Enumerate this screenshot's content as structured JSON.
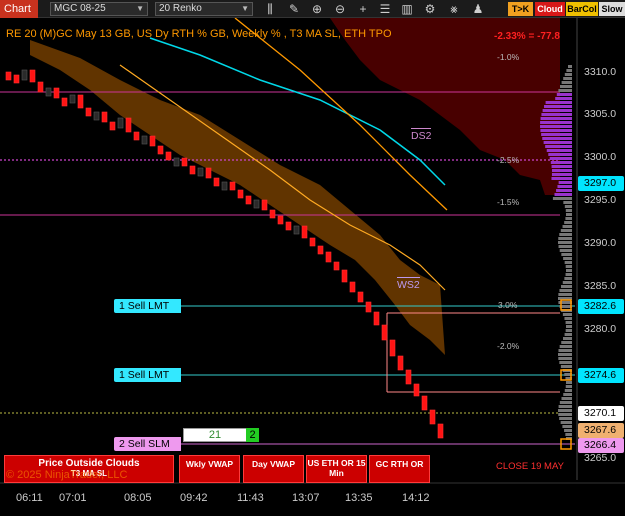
{
  "toolbar": {
    "title": "Chart",
    "instrument": "MGC 08-25",
    "bar_type": "20 Renko",
    "icons": [
      "bars-icon",
      "draw-icon",
      "zoom-in-icon",
      "zoom-out-icon",
      "add-icon",
      "list-icon",
      "chart-style-icon",
      "properties-icon",
      "indicators-icon",
      "strategies-icon"
    ],
    "buttons": {
      "tk": "T>K",
      "cloud": "Cloud",
      "barcol": "BarCol",
      "slow": "Slow"
    }
  },
  "header_text": "RE 20  (M)GC May 13 GB, US Dy RTH % GB, Weekly % , T3 MA SL, ETH TPO",
  "top_percent": "-2.33% = -77.8",
  "price_axis": [
    "3310.0",
    "3305.0",
    "3300.0",
    "3295.0",
    "3290.0",
    "3285.0",
    "3280.0",
    "3275.0",
    "3270.0",
    "3265.0"
  ],
  "time_axis": [
    "06:11",
    "07:01",
    "08:05",
    "09:42",
    "11:43",
    "13:07",
    "13:35",
    "14:12"
  ],
  "price_tags": {
    "cyan_top": "3297.0",
    "sell_1": "3282.6",
    "sell_2": "3274.6",
    "current": "3270.1",
    "bar_close": "3267.6",
    "slm": "3266.4"
  },
  "orders": [
    {
      "label": "1 Sell LMT"
    },
    {
      "label": "1 Sell LMT"
    },
    {
      "label": "2 Sell SLM"
    }
  ],
  "pct_labels": {
    "p1": "-1.0%",
    "p2": "-2.5%",
    "p3": "-1.5%",
    "p4": "3.0%",
    "p5": "-2.0%"
  },
  "annotations": {
    "ds2": "DS2",
    "ws2": "WS2"
  },
  "position_box": {
    "qty": "21",
    "count": "2"
  },
  "panels": {
    "price_outside": "Price Outside Clouds",
    "t3": "T3 MA SL",
    "wkly": "Wkly VWAP",
    "day": "Day VWAP",
    "us_eth": "US ETH OR 15 Min",
    "gc_rth": "GC RTH OR"
  },
  "close_note": "CLOSE 19 MAY",
  "copyright": "© 2025 NinjaTrader, LLC",
  "colors": {
    "up_bar": "#2a2a2a",
    "down_bar": "#ff1414",
    "cloud": "#a05a00",
    "upper_cloud": "#5a0000",
    "tpo": "#9933cc",
    "cyan": "#00e5ff",
    "orange": "#ff9900"
  }
}
